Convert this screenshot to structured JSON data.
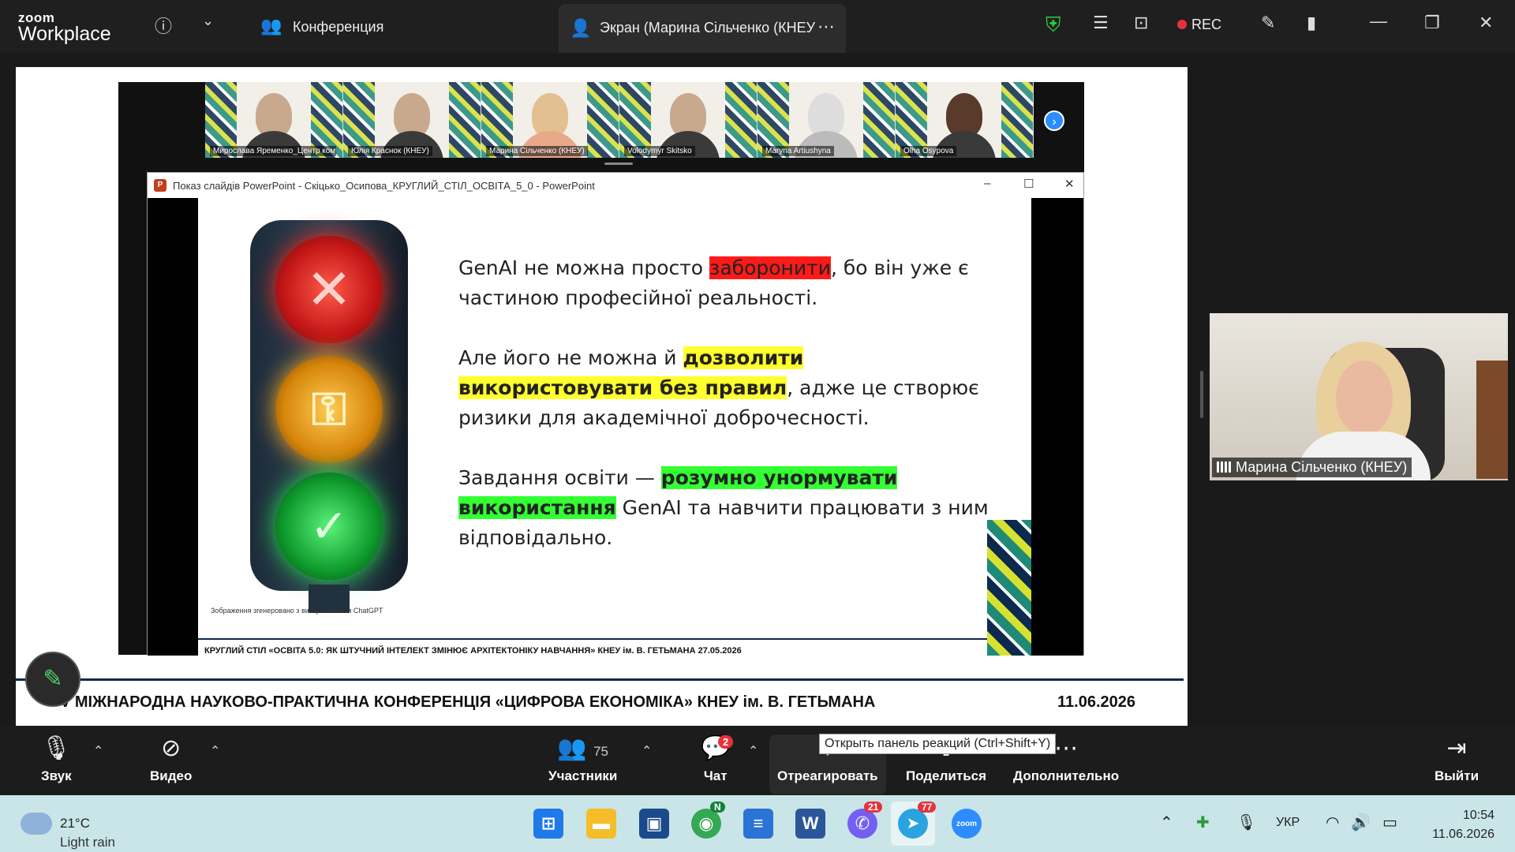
{
  "titlebar": {
    "logo_top": "zoom",
    "logo_bottom": "Workplace",
    "conference_label": "Конференция",
    "share_tab_label": "Экран (Марина Сільченко (КНЕУ",
    "rec_label": "REC"
  },
  "participants_strip": [
    {
      "name": "Мирослава Яременко_Центр кому..."
    },
    {
      "name": "Юлія Краснок (КНЕУ)"
    },
    {
      "name": "Марина Сільченко (КНЕУ)"
    },
    {
      "name": "Volodymyr Skitsko"
    },
    {
      "name": "Maryna Artiushyna"
    },
    {
      "name": "Olha Osypova"
    }
  ],
  "ppt": {
    "title": "Показ слайдів PowerPoint  -  Скіцько_Осипова_КРУГЛИЙ_СТІЛ_ОСВІТА_5_0 - PowerPoint",
    "min": "–",
    "max": "☐",
    "close": "✕"
  },
  "slide": {
    "p1_a": "GenAI не можна просто ",
    "p1_hl": "заборонити",
    "p1_b": ", бо він уже є частиною професійної реальності.",
    "p2_a": "Але його не можна й ",
    "p2_hl": "дозволити використовувати без правил",
    "p2_b": ", адже це створює ризики для академічної доброчесності.",
    "p3_a": "Завдання освіти — ",
    "p3_hl": "розумно унормувати використання",
    "p3_b": " GenAI та навчити працювати з ним відповідально.",
    "image_caption": "Зображення згенеровано з використанням ChatGPT",
    "footer": "КРУГЛИЙ СТІЛ «ОСВІТА 5.0: ЯК ШТУЧНИЙ ІНТЕЛЕКТ ЗМІНЮЄ АРХІТЕКТОНІКУ НАВЧАННЯ»          КНЕУ ім. В. ГЕТЬМАНА     27.05.2026"
  },
  "conference_banner": {
    "text": "V МІЖНАРОДНА НАУКОВО-ПРАКТИЧНА КОНФЕРЕНЦІЯ «ЦИФРОВА ЕКОНОМІКА»   КНЕУ ім. В. ГЕТЬМАНА",
    "date": "11.06.2026"
  },
  "speaker": {
    "name": "Марина Сільченко (КНЕУ)"
  },
  "toolbar": {
    "audio_label": "Звук",
    "video_label": "Видео",
    "participants_label": "Участники",
    "participants_count": "75",
    "chat_label": "Чат",
    "chat_badge": "2",
    "react_label": "Отреагировать",
    "share_label": "Поделиться",
    "more_label": "Дополнительно",
    "leave_label": "Выйти",
    "tooltip": "Открыть панель реакций (Ctrl+Shift+Y)"
  },
  "taskbar": {
    "temp": "21°C",
    "weather": "Light rain",
    "chrome_badge": "N",
    "viber_badge": "21",
    "telegram_badge": "77",
    "zoom_label": "zoom",
    "lang": "УКР",
    "time": "10:54",
    "date": "11.06.2026"
  },
  "colors": {
    "highlight_red": "#ff1a1a",
    "highlight_yellow": "#ffff2e",
    "highlight_green": "#33ff33",
    "zoom_blue": "#2d8cff",
    "rec_red": "#e5333b"
  }
}
